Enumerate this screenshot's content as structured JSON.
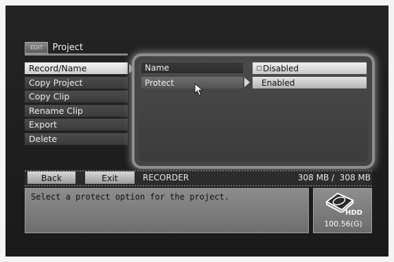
{
  "header": {
    "edit_tag": "EDIT",
    "title": "Project"
  },
  "menu": {
    "items": [
      {
        "label": "Record/Name"
      },
      {
        "label": "Copy Project"
      },
      {
        "label": "Copy Clip"
      },
      {
        "label": "Rename Clip"
      },
      {
        "label": "Export"
      },
      {
        "label": "Delete"
      }
    ]
  },
  "options": {
    "name_label": "Name",
    "protect_label": "Protect",
    "disabled_label": "Disabled",
    "enabled_label": "Enabled"
  },
  "footer": {
    "back": "Back",
    "exit": "Exit",
    "source": "RECORDER",
    "capacity": "308 MB /  308 MB"
  },
  "message": "Select a protect option for the project.",
  "hdd": {
    "label": "HDD",
    "capacity": "100.56(G)"
  },
  "icons": [
    "hdd-icon",
    "pointer-cursor-icon",
    "right-arrow-icon"
  ]
}
